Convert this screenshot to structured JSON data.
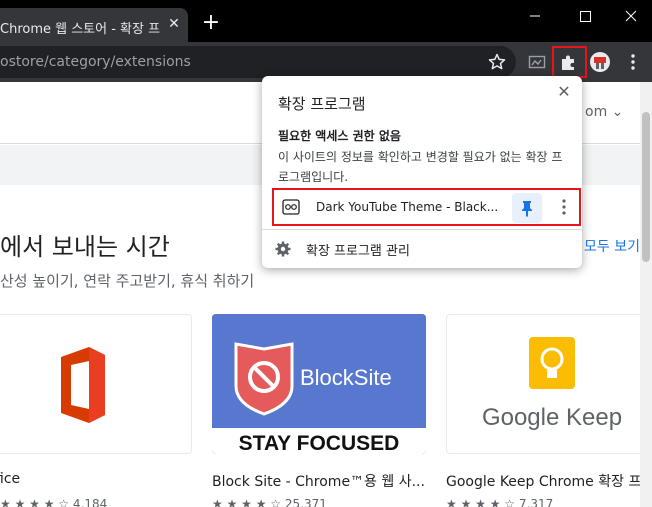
{
  "browser": {
    "tab_title": "Chrome 웹 스토어 - 확장 프로그램",
    "tab_close_icon": "close-icon",
    "new_tab_label": "+",
    "url": "ostore/category/extensions",
    "bookmark_icon": "star-icon",
    "extensions_icon": "puzzle-icon",
    "menu_icon": "vertical-dots-icon"
  },
  "page": {
    "nav_more_label": "om",
    "heading": "에서 보내는 시간",
    "subheading": "산성 높이기, 연락 주고받기, 휴식 취하기",
    "see_all_label": "모두 보기",
    "cards": [
      {
        "title": "fice",
        "rating_count": "4,184",
        "brand_color": "#d83b01"
      },
      {
        "title": "Block Site - Chrome™용 웹 사...",
        "rating_count": "25,371",
        "banner_text": "BlockSite",
        "tagline": "STAY FOCUSED"
      },
      {
        "title": "Google Keep Chrome 확장 프",
        "rating_count": "7,317",
        "logo_text": "Google Keep"
      }
    ]
  },
  "popup": {
    "title": "확장 프로그램",
    "close_label": "✕",
    "section_heading": "필요한 액세스 권한 없음",
    "section_desc": "이 사이트의 정보를 확인하고 변경할 필요가 없는 확장 프로그램입니다.",
    "extension": {
      "name": "Dark YouTube Theme - Black...",
      "pinned": true
    },
    "manage_label": "확장 프로그램 관리"
  },
  "colors": {
    "highlight": "#e8141c",
    "accent": "#1a73e8",
    "toolbar": "#35363a",
    "titlebar": "#000000"
  }
}
